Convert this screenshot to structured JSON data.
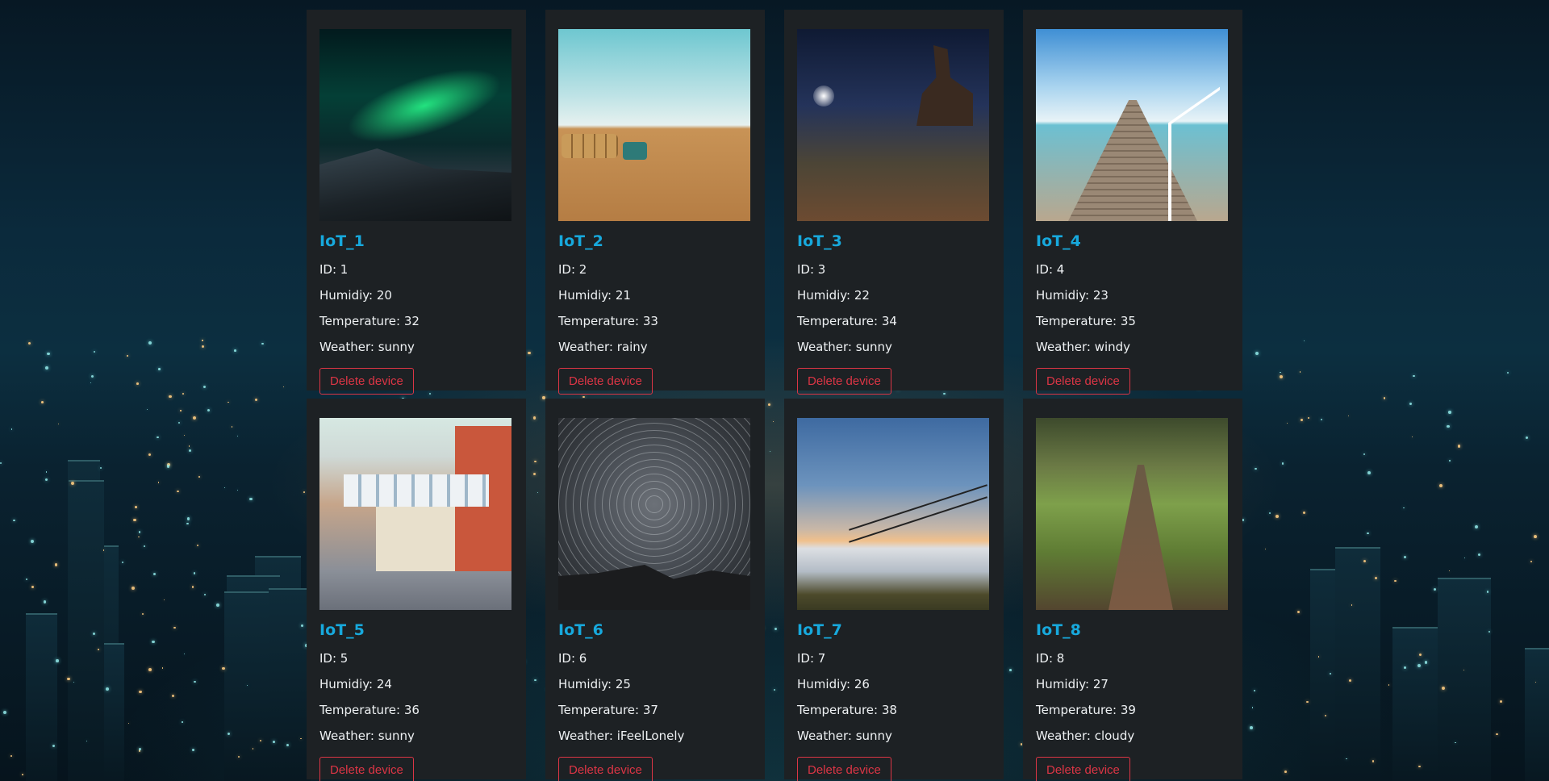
{
  "devices": [
    {
      "title": "IoT_1",
      "id": "1",
      "humidity": "20",
      "temperature": "32",
      "weather": "sunny",
      "image": "aurora"
    },
    {
      "title": "IoT_2",
      "id": "2",
      "humidity": "21",
      "temperature": "33",
      "weather": "rainy",
      "image": "field"
    },
    {
      "title": "IoT_3",
      "id": "3",
      "humidity": "22",
      "temperature": "34",
      "weather": "sunny",
      "image": "moon"
    },
    {
      "title": "IoT_4",
      "id": "4",
      "humidity": "23",
      "temperature": "35",
      "weather": "windy",
      "image": "pier"
    },
    {
      "title": "IoT_5",
      "id": "5",
      "humidity": "24",
      "temperature": "36",
      "weather": "sunny",
      "image": "street"
    },
    {
      "title": "IoT_6",
      "id": "6",
      "humidity": "25",
      "temperature": "37",
      "weather": "iFeelLonely",
      "image": "stars"
    },
    {
      "title": "IoT_7",
      "id": "7",
      "humidity": "26",
      "temperature": "38",
      "weather": "sunny",
      "image": "sunset"
    },
    {
      "title": "IoT_8",
      "id": "8",
      "humidity": "27",
      "temperature": "39",
      "weather": "cloudy",
      "image": "forest"
    }
  ],
  "labels": {
    "id": "ID: ",
    "humidity": "Humidiy: ",
    "temperature": "Temperature: ",
    "weather": "Weather: ",
    "delete_button": "Delete device"
  },
  "colors": {
    "card_bg": "#1d2124",
    "title": "#17a9dd",
    "danger": "#dc3545",
    "text": "#eef1f3"
  }
}
